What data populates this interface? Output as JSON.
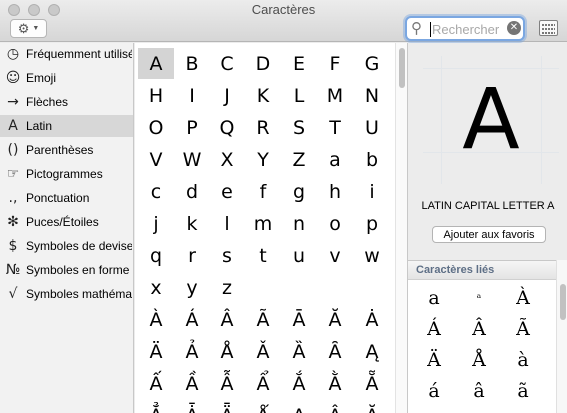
{
  "window": {
    "title": "Caractères"
  },
  "toolbar": {
    "gear_icon": "gear-icon",
    "search_placeholder": "Rechercher"
  },
  "sidebar": {
    "items": [
      {
        "icon": "◷",
        "label": "Fréquemment utilisés"
      },
      {
        "icon": "☺",
        "label": "Emoji"
      },
      {
        "icon": "→",
        "label": "Flèches"
      },
      {
        "icon": "A",
        "label": "Latin"
      },
      {
        "icon": "()",
        "label": "Parenthèses"
      },
      {
        "icon": "☞",
        "label": "Pictogrammes"
      },
      {
        "icon": ".,",
        "label": "Ponctuation"
      },
      {
        "icon": "✻",
        "label": "Puces/Étoiles"
      },
      {
        "icon": "$",
        "label": "Symboles de devises"
      },
      {
        "icon": "№",
        "label": "Symboles en forme de lettres"
      },
      {
        "icon": "√",
        "label": "Symboles mathématiques"
      }
    ],
    "selected": "Latin"
  },
  "grid": {
    "rows": [
      [
        "A",
        "B",
        "C",
        "D",
        "E",
        "F",
        "G"
      ],
      [
        "H",
        "I",
        "J",
        "K",
        "L",
        "M",
        "N"
      ],
      [
        "O",
        "P",
        "Q",
        "R",
        "S",
        "T",
        "U"
      ],
      [
        "V",
        "W",
        "X",
        "Y",
        "Z",
        "a",
        "b"
      ],
      [
        "c",
        "d",
        "e",
        "f",
        "g",
        "h",
        "i"
      ],
      [
        "j",
        "k",
        "l",
        "m",
        "n",
        "o",
        "p"
      ],
      [
        "q",
        "r",
        "s",
        "t",
        "u",
        "v",
        "w"
      ],
      [
        "x",
        "y",
        "z",
        "",
        "",
        "",
        ""
      ],
      [
        "À",
        "Á",
        "Â",
        "Ã",
        "Ā",
        "Ă",
        "Ȧ"
      ],
      [
        "Ä",
        "Ả",
        "Å",
        "Ǎ",
        "Ȁ",
        "Ȃ",
        "Ą"
      ],
      [
        "Ấ",
        "Ầ",
        "Ẫ",
        "Ẩ",
        "Ắ",
        "Ằ",
        "Ẵ"
      ],
      [
        "Ẳ",
        "Ǡ",
        "Ǟ",
        "Ǻ",
        "Ạ",
        "Ậ",
        "Ặ"
      ]
    ],
    "selected": "A"
  },
  "detail": {
    "char": "A",
    "name": "LATIN CAPITAL LETTER A",
    "fav_button": "Ajouter aux favoris",
    "related_header": "Caractères liés",
    "related": [
      [
        "a",
        "ᵃ",
        "À"
      ],
      [
        "Á",
        "Â",
        "Ã"
      ],
      [
        "Ä",
        "Å",
        "à"
      ],
      [
        "á",
        "â",
        "ã"
      ]
    ]
  }
}
